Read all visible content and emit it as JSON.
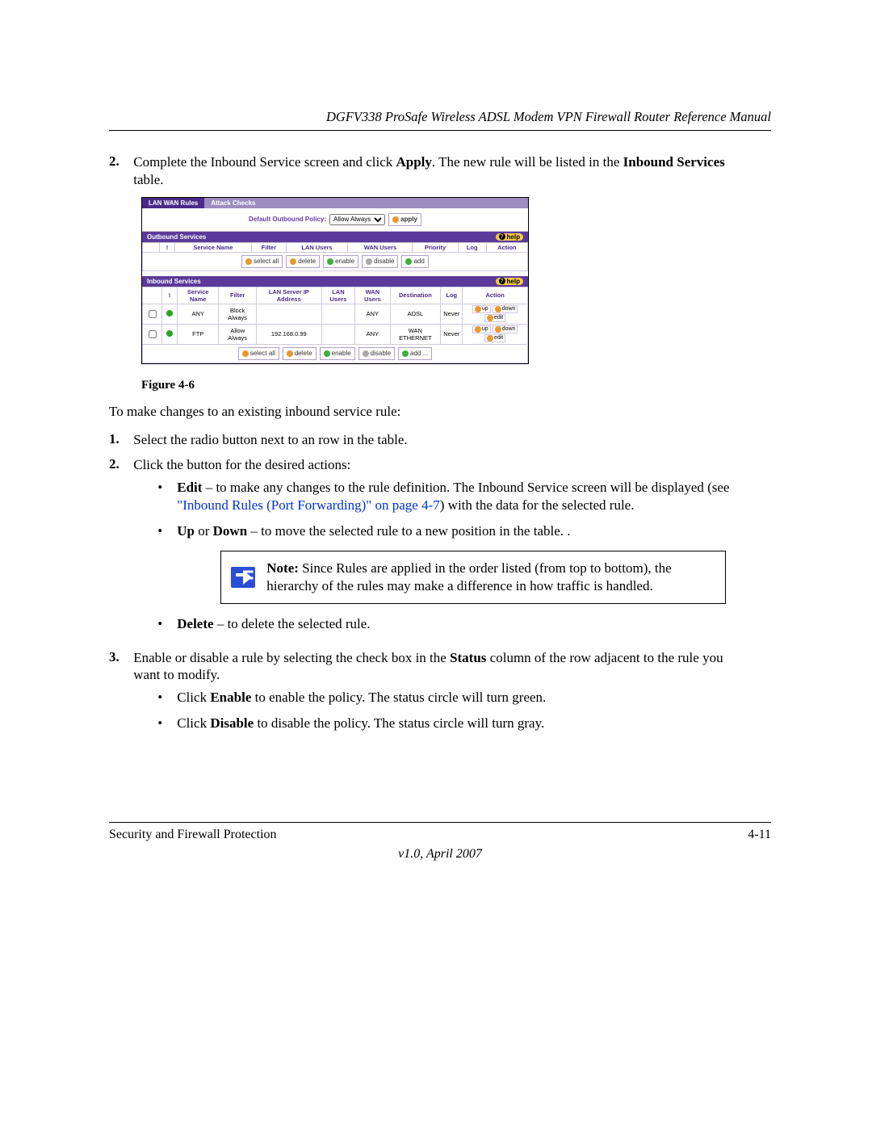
{
  "header": {
    "running_title": "DGFV338 ProSafe Wireless ADSL Modem VPN Firewall Router Reference Manual"
  },
  "step2": {
    "num": "2.",
    "text_a": "Complete the Inbound Service screen and click ",
    "text_b": "Apply",
    "text_c": ". The new rule will be listed in the ",
    "text_d": "Inbound Services",
    "text_e": " table."
  },
  "screenshot": {
    "tabs": {
      "active": "LAN WAN Rules",
      "other": "Attack Checks"
    },
    "policy_label": "Default Outbound Policy:",
    "policy_value": "Allow Always",
    "apply": "apply",
    "help": "help",
    "outbound": {
      "title": "Outbound Services",
      "cols": [
        "",
        "!",
        "Service Name",
        "Filter",
        "LAN Users",
        "WAN Users",
        "Priority",
        "Log",
        "Action"
      ]
    },
    "btns": {
      "select_all": "select all",
      "delete": "delete",
      "enable": "enable",
      "disable": "disable",
      "add": "add",
      "add_ell": "add ..."
    },
    "inbound": {
      "title": "Inbound Services",
      "cols": [
        "",
        "!",
        "Service Name",
        "Filter",
        "LAN Server IP Address",
        "LAN Users",
        "WAN Users",
        "Destination",
        "Log",
        "Action"
      ],
      "rows": [
        {
          "service": "ANY",
          "filter": "Block Always",
          "ip": "",
          "lan": "",
          "wan": "ANY",
          "dest": "ADSL",
          "log": "Never"
        },
        {
          "service": "FTP",
          "filter": "Allow Always",
          "ip": "192.168.0.99",
          "lan": "",
          "wan": "ANY",
          "dest": "WAN ETHERNET",
          "log": "Never"
        }
      ],
      "actions": {
        "up": "up",
        "down": "down",
        "edit": "edit"
      }
    }
  },
  "caption": "Figure 4-6",
  "lead": "To make changes to an existing inbound service rule:",
  "step1b": {
    "num": "1.",
    "text": "Select the radio button next to an row in the table."
  },
  "step2b": {
    "num": "2.",
    "text": "Click the button for the desired actions:",
    "edit": {
      "b": "Edit",
      "t1": " – to make any changes to the rule definition. The Inbound Service screen will be displayed (see ",
      "link": "\"Inbound Rules (Port Forwarding)\" on page 4-7",
      "t2": ") with the data for the selected rule."
    },
    "updown": {
      "b1": "Up",
      "mid": " or ",
      "b2": "Down",
      "t": " – to move the selected rule to a new position in the table. ."
    },
    "note": {
      "b": "Note:",
      "t": " Since Rules are applied in the order listed (from top to bottom), the hierarchy of the rules may make a difference in how traffic is handled."
    },
    "delete": {
      "b": "Delete",
      "t": " – to delete the selected rule."
    }
  },
  "step3b": {
    "num": "3.",
    "text_a": "Enable or disable a rule by selecting the check box in the ",
    "text_b": "Status",
    "text_c": " column of the row adjacent to the rule you want to modify.",
    "en": {
      "pre": "Click ",
      "b": "Enable",
      "t": " to enable the policy. The status circle will turn green."
    },
    "dis": {
      "pre": "Click ",
      "b": "Disable",
      "t": " to disable the policy. The status circle will turn gray."
    }
  },
  "footer": {
    "left": "Security and Firewall Protection",
    "right": "4-11",
    "version": "v1.0, April 2007"
  }
}
